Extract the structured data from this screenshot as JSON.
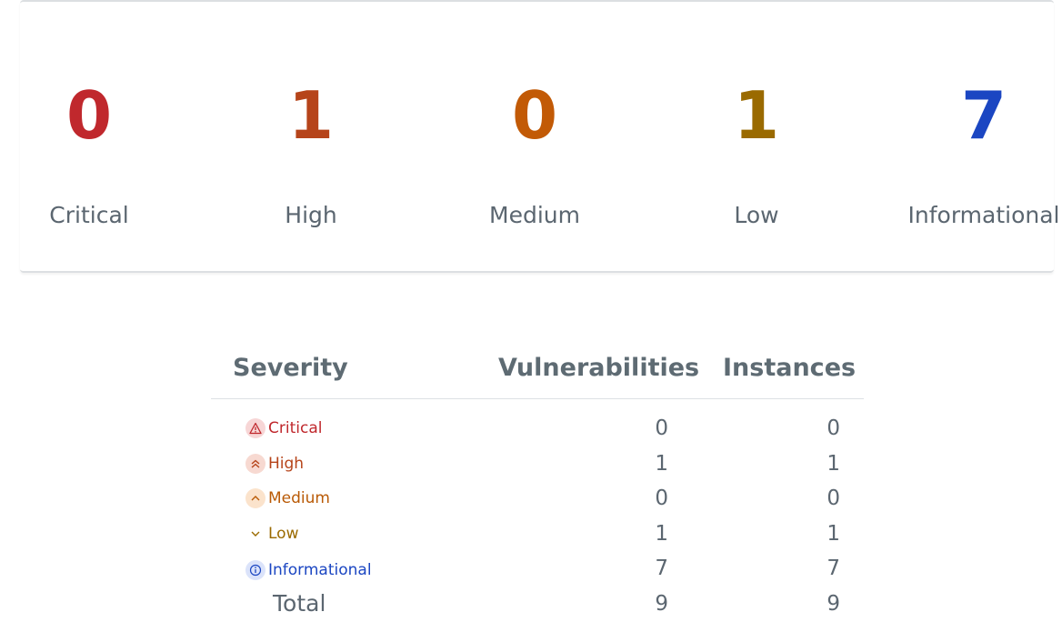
{
  "summary": [
    {
      "count": "0",
      "label": "Critical",
      "color": "#c0282d"
    },
    {
      "count": "1",
      "label": "High",
      "color": "#b6441a"
    },
    {
      "count": "0",
      "label": "Medium",
      "color": "#c25a06"
    },
    {
      "count": "1",
      "label": "Low",
      "color": "#9a6a00"
    },
    {
      "count": "7",
      "label": "Informational",
      "color": "#1b46c2"
    }
  ],
  "table": {
    "headers": {
      "severity": "Severity",
      "vulnerabilities": "Vulnerabilities",
      "instances": "Instances"
    },
    "rows": [
      {
        "severity": "Critical",
        "icon": "warning-triangle-icon",
        "vulnerabilities": "0",
        "instances": "0",
        "color": "#c0282d",
        "badge_bg": "#f7d6d6"
      },
      {
        "severity": "High",
        "icon": "double-chevron-up-icon",
        "vulnerabilities": "1",
        "instances": "1",
        "color": "#b6441a",
        "badge_bg": "#f7d9d1"
      },
      {
        "severity": "Medium",
        "icon": "chevron-up-icon",
        "vulnerabilities": "0",
        "instances": "0",
        "color": "#b95a06",
        "badge_bg": "#fbe3cc"
      },
      {
        "severity": "Low",
        "icon": "chevron-down-icon",
        "vulnerabilities": "1",
        "instances": "1",
        "color": "#9a6a00",
        "badge_bg": "transparent"
      },
      {
        "severity": "Informational",
        "icon": "info-circle-icon",
        "vulnerabilities": "7",
        "instances": "7",
        "color": "#1b46c2",
        "badge_bg": "#dbe3fa"
      }
    ],
    "total": {
      "label": "Total",
      "vulnerabilities": "9",
      "instances": "9"
    }
  }
}
